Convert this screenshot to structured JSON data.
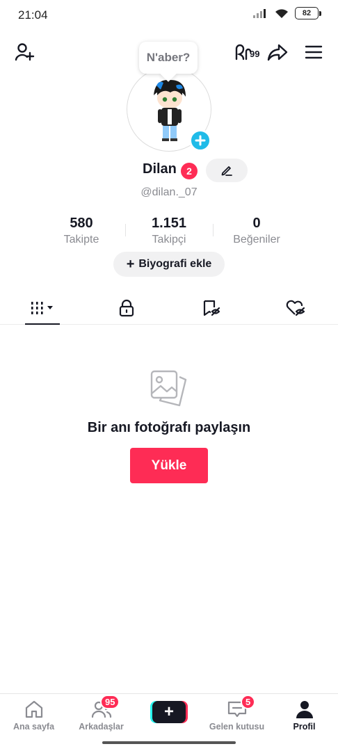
{
  "status_bar": {
    "time": "21:04",
    "battery": "82"
  },
  "top_bar": {
    "friends_count_label": "99"
  },
  "tooltip": {
    "text": "N'aber?"
  },
  "profile": {
    "name": "Dilan",
    "name_badge": "2",
    "handle": "@dilan._07"
  },
  "stats": [
    {
      "value": "580",
      "label": "Takipte"
    },
    {
      "value": "1.151",
      "label": "Takipçi"
    },
    {
      "value": "0",
      "label": "Beğeniler"
    }
  ],
  "bio_button": {
    "label": "Biyografi ekle"
  },
  "empty_state": {
    "title": "Bir anı fotoğrafı paylaşın",
    "button": "Yükle"
  },
  "bottom_nav": {
    "home": "Ana sayfa",
    "friends": "Arkadaşlar",
    "friends_badge": "95",
    "inbox": "Gelen kutusu",
    "inbox_badge": "5",
    "profile": "Profil"
  },
  "colors": {
    "accent": "#fe2c55",
    "avatar_add": "#20bbe8",
    "text_primary": "#161823",
    "text_secondary": "#8a8b91"
  }
}
